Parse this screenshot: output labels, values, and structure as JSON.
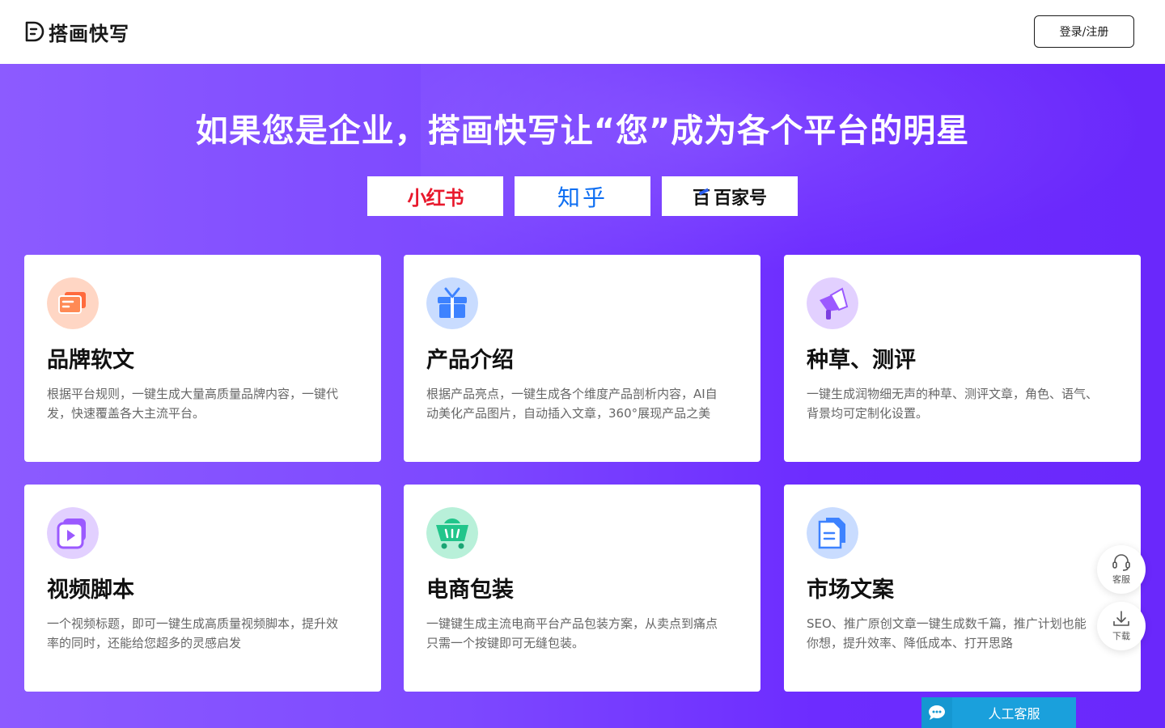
{
  "header": {
    "brand": "搭画快写",
    "login_label": "登录/注册"
  },
  "hero": {
    "title": "如果您是企业，搭画快写让“您”成为各个平台的明星",
    "platforms": [
      "小红书",
      "知乎",
      "百家号"
    ]
  },
  "cards": [
    {
      "title": "品牌软文",
      "desc_lines": [
        "根据平台规则，一键生成大量高质量品牌内容，一键代",
        "发，快速覆盖各大主流平台。"
      ],
      "icon": "message-icon",
      "color": "#ff6a3d"
    },
    {
      "title": "产品介绍",
      "desc_lines": [
        "根据产品亮点，一键生成各个维度产品剖析内容，AI自",
        "动美化产品图片，自动插入文章，360°展现产品之美"
      ],
      "icon": "gift-icon",
      "color": "#3d82ff"
    },
    {
      "title": "种草、测评",
      "desc_lines": [
        "一键生成润物细无声的种草、测评文章，角色、语气、",
        "背景均可定制化设置。"
      ],
      "icon": "megaphone-icon",
      "color": "#9b59ff"
    },
    {
      "title": "视频脚本",
      "desc_lines": [
        "一个视频标题，即可一键生成高质量视频脚本，提升效",
        "率的同时，还能给您超多的灵感启发"
      ],
      "icon": "video-icon",
      "color": "#9b59ff"
    },
    {
      "title": "电商包装",
      "desc_lines": [
        "一键键生成主流电商平台产品包装方案，从卖点到痛点",
        "只需一个按键即可无缝包装。"
      ],
      "icon": "cart-icon",
      "color": "#22c58b"
    },
    {
      "title": "市场文案",
      "desc_lines": [
        "SEO、推广原创文章一键生成数千篇，推广计划也能",
        "你想，提升效率、降低成本、打开思路"
      ],
      "icon": "document-icon",
      "color": "#3d82ff"
    }
  ],
  "floating": {
    "service_label": "客服",
    "download_label": "下载"
  },
  "chat": {
    "label": "人工客服"
  }
}
